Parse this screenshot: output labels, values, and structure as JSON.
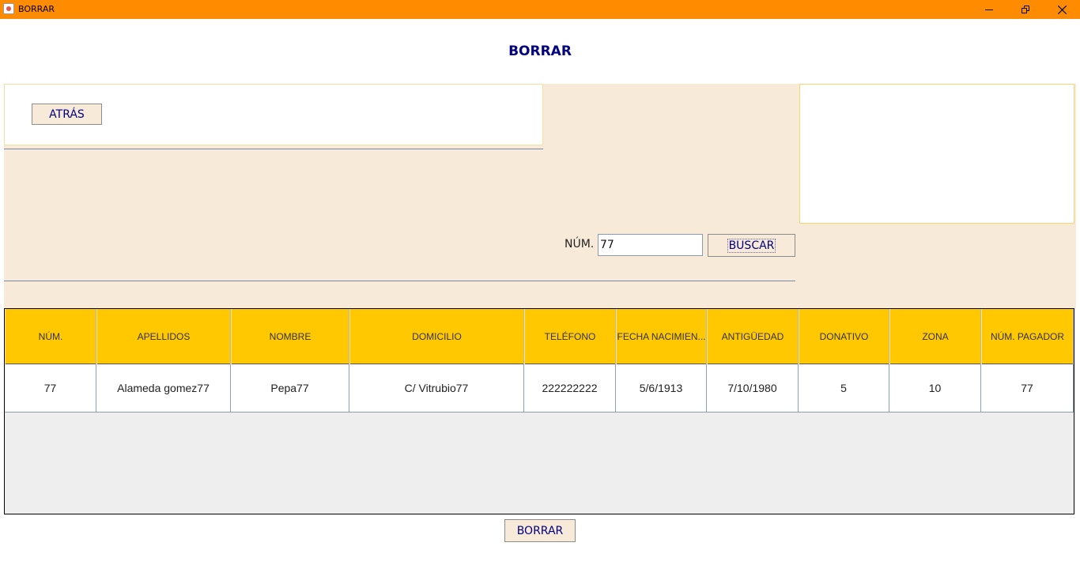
{
  "window": {
    "title": "BORRAR",
    "controls": {
      "minimize": "minimize-icon",
      "maximize": "restore-icon",
      "close": "close-icon"
    }
  },
  "heading": "BORRAR",
  "back_button": "ATRÁS",
  "search": {
    "label": "NÚM.",
    "value": "77",
    "button": "BUSCAR"
  },
  "table": {
    "columns": [
      "NÚM.",
      "APELLIDOS",
      "NOMBRE",
      "DOMICILIO",
      "TELÉFONO",
      "FECHA NACIMIEN...",
      "ANTIGÜEDAD",
      "DONATIVO",
      "ZONA",
      "NÚM. PAGADOR"
    ],
    "rows": [
      [
        "77",
        "Alameda gomez77",
        "Pepa77",
        "C/ Vitrubio77",
        "222222222",
        "5/6/1913",
        "7/10/1980",
        "5",
        "10",
        "77"
      ]
    ]
  },
  "delete_button": "BORRAR",
  "colors": {
    "titlebar": "#ff8c00",
    "header": "#ffc800",
    "panel": "#f8ead8",
    "text_accent": "#000080"
  }
}
